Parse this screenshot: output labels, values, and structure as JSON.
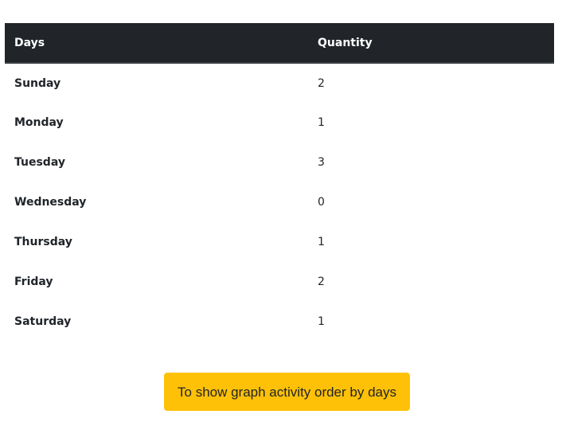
{
  "table": {
    "headers": {
      "days": "Days",
      "quantity": "Quantity"
    },
    "rows": [
      {
        "day": "Sunday",
        "quantity": "2"
      },
      {
        "day": "Monday",
        "quantity": "1"
      },
      {
        "day": "Tuesday",
        "quantity": "3"
      },
      {
        "day": "Wednesday",
        "quantity": "0"
      },
      {
        "day": "Thursday",
        "quantity": "1"
      },
      {
        "day": "Friday",
        "quantity": "2"
      },
      {
        "day": "Saturday",
        "quantity": "1"
      }
    ]
  },
  "actions": {
    "show_graph_label": "To show graph activity order by days"
  },
  "colors": {
    "header_bg": "#212529",
    "button_bg": "#ffc107"
  }
}
